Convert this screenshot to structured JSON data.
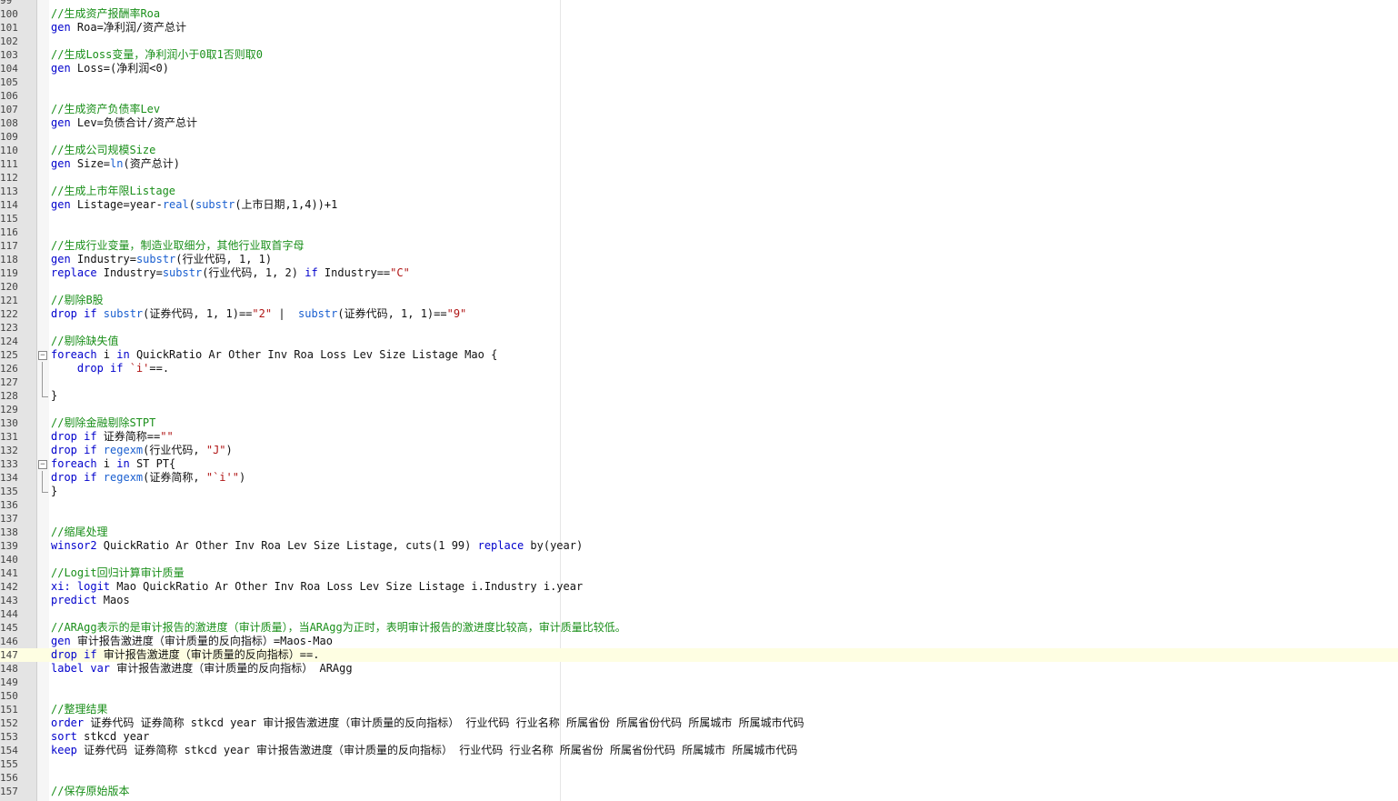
{
  "editor": {
    "current_line": 147,
    "colors": {
      "comment": "#1a8f1a",
      "keyword": "#0000cc",
      "function": "#1a5fd0",
      "string": "#b01515",
      "text": "#111111",
      "gutter": "#e4e4e4",
      "current_line": "#fefee2"
    },
    "lines": [
      {
        "n": "99",
        "tokens": []
      },
      {
        "n": "100",
        "tokens": [
          {
            "t": "c",
            "v": "//生成资产报酬率Roa"
          }
        ]
      },
      {
        "n": "101",
        "tokens": [
          {
            "t": "k",
            "v": "gen "
          },
          {
            "t": "x",
            "v": "Roa=净利润/资产总计"
          }
        ]
      },
      {
        "n": "102",
        "tokens": []
      },
      {
        "n": "103",
        "tokens": [
          {
            "t": "c",
            "v": "//生成Loss变量，净利润小于0取1否则取0"
          }
        ]
      },
      {
        "n": "104",
        "tokens": [
          {
            "t": "k",
            "v": "gen "
          },
          {
            "t": "x",
            "v": "Loss=(净利润<0)"
          }
        ]
      },
      {
        "n": "105",
        "tokens": []
      },
      {
        "n": "106",
        "tokens": []
      },
      {
        "n": "107",
        "tokens": [
          {
            "t": "c",
            "v": "//生成资产负债率Lev"
          }
        ]
      },
      {
        "n": "108",
        "tokens": [
          {
            "t": "k",
            "v": "gen "
          },
          {
            "t": "x",
            "v": "Lev=负债合计/资产总计"
          }
        ]
      },
      {
        "n": "109",
        "tokens": []
      },
      {
        "n": "110",
        "tokens": [
          {
            "t": "c",
            "v": "//生成公司规模Size"
          }
        ]
      },
      {
        "n": "111",
        "tokens": [
          {
            "t": "k",
            "v": "gen "
          },
          {
            "t": "x",
            "v": "Size="
          },
          {
            "t": "f",
            "v": "ln"
          },
          {
            "t": "x",
            "v": "(资产总计)"
          }
        ]
      },
      {
        "n": "112",
        "tokens": []
      },
      {
        "n": "113",
        "tokens": [
          {
            "t": "c",
            "v": "//生成上市年限Listage"
          }
        ]
      },
      {
        "n": "114",
        "tokens": [
          {
            "t": "k",
            "v": "gen "
          },
          {
            "t": "x",
            "v": "Listage=year-"
          },
          {
            "t": "f",
            "v": "real"
          },
          {
            "t": "x",
            "v": "("
          },
          {
            "t": "f",
            "v": "substr"
          },
          {
            "t": "x",
            "v": "(上市日期,1,4))+1"
          }
        ]
      },
      {
        "n": "115",
        "tokens": []
      },
      {
        "n": "116",
        "tokens": []
      },
      {
        "n": "117",
        "tokens": [
          {
            "t": "c",
            "v": "//生成行业变量，制造业取细分，其他行业取首字母"
          }
        ]
      },
      {
        "n": "118",
        "tokens": [
          {
            "t": "k",
            "v": "gen "
          },
          {
            "t": "x",
            "v": "Industry="
          },
          {
            "t": "f",
            "v": "substr"
          },
          {
            "t": "x",
            "v": "(行业代码, 1, 1)"
          }
        ]
      },
      {
        "n": "119",
        "tokens": [
          {
            "t": "k",
            "v": "replace "
          },
          {
            "t": "x",
            "v": "Industry="
          },
          {
            "t": "f",
            "v": "substr"
          },
          {
            "t": "x",
            "v": "(行业代码, 1, 2) "
          },
          {
            "t": "k",
            "v": "if "
          },
          {
            "t": "x",
            "v": "Industry=="
          },
          {
            "t": "s",
            "v": "\"C\""
          }
        ]
      },
      {
        "n": "120",
        "tokens": []
      },
      {
        "n": "121",
        "tokens": [
          {
            "t": "c",
            "v": "//剔除B股"
          }
        ]
      },
      {
        "n": "122",
        "tokens": [
          {
            "t": "k",
            "v": "drop if "
          },
          {
            "t": "f",
            "v": "substr"
          },
          {
            "t": "x",
            "v": "(证券代码, 1, 1)=="
          },
          {
            "t": "s",
            "v": "\"2\""
          },
          {
            "t": "x",
            "v": " |  "
          },
          {
            "t": "f",
            "v": "substr"
          },
          {
            "t": "x",
            "v": "(证券代码, 1, 1)=="
          },
          {
            "t": "s",
            "v": "\"9\""
          }
        ]
      },
      {
        "n": "123",
        "tokens": []
      },
      {
        "n": "124",
        "tokens": [
          {
            "t": "c",
            "v": "//剔除缺失值"
          }
        ]
      },
      {
        "n": "125",
        "fold": "open",
        "tokens": [
          {
            "t": "k",
            "v": "foreach "
          },
          {
            "t": "x",
            "v": "i "
          },
          {
            "t": "k",
            "v": "in "
          },
          {
            "t": "x",
            "v": "QuickRatio Ar Other Inv Roa Loss Lev Size Listage Mao {"
          }
        ]
      },
      {
        "n": "126",
        "fold": "mid",
        "tokens": [
          {
            "t": "x",
            "v": "    "
          },
          {
            "t": "k",
            "v": "drop if "
          },
          {
            "t": "s",
            "v": "`i'"
          },
          {
            "t": "x",
            "v": "==."
          }
        ]
      },
      {
        "n": "127",
        "fold": "mid",
        "tokens": []
      },
      {
        "n": "128",
        "fold": "end",
        "tokens": [
          {
            "t": "x",
            "v": "}"
          }
        ]
      },
      {
        "n": "129",
        "tokens": []
      },
      {
        "n": "130",
        "tokens": [
          {
            "t": "c",
            "v": "//剔除金融剔除STPT"
          }
        ]
      },
      {
        "n": "131",
        "tokens": [
          {
            "t": "k",
            "v": "drop if "
          },
          {
            "t": "x",
            "v": "证券简称=="
          },
          {
            "t": "s",
            "v": "\"\""
          }
        ]
      },
      {
        "n": "132",
        "tokens": [
          {
            "t": "k",
            "v": "drop if "
          },
          {
            "t": "f",
            "v": "regexm"
          },
          {
            "t": "x",
            "v": "(行业代码, "
          },
          {
            "t": "s",
            "v": "\"J\""
          },
          {
            "t": "x",
            "v": ")"
          }
        ]
      },
      {
        "n": "133",
        "fold": "open",
        "tokens": [
          {
            "t": "k",
            "v": "foreach "
          },
          {
            "t": "x",
            "v": "i "
          },
          {
            "t": "k",
            "v": "in "
          },
          {
            "t": "x",
            "v": "ST PT{"
          }
        ]
      },
      {
        "n": "134",
        "fold": "mid",
        "tokens": [
          {
            "t": "k",
            "v": "drop if "
          },
          {
            "t": "f",
            "v": "regexm"
          },
          {
            "t": "x",
            "v": "(证券简称, "
          },
          {
            "t": "s",
            "v": "\"`i'\""
          },
          {
            "t": "x",
            "v": ")"
          }
        ]
      },
      {
        "n": "135",
        "fold": "end",
        "tokens": [
          {
            "t": "x",
            "v": "}"
          }
        ]
      },
      {
        "n": "136",
        "tokens": []
      },
      {
        "n": "137",
        "tokens": []
      },
      {
        "n": "138",
        "tokens": [
          {
            "t": "c",
            "v": "//缩尾处理"
          }
        ]
      },
      {
        "n": "139",
        "tokens": [
          {
            "t": "k",
            "v": "winsor2 "
          },
          {
            "t": "x",
            "v": "QuickRatio Ar Other Inv Roa Lev Size Listage, cuts(1 99) "
          },
          {
            "t": "k",
            "v": "replace "
          },
          {
            "t": "x",
            "v": "by(year)"
          }
        ]
      },
      {
        "n": "140",
        "tokens": []
      },
      {
        "n": "141",
        "tokens": [
          {
            "t": "c",
            "v": "//Logit回归计算审计质量"
          }
        ]
      },
      {
        "n": "142",
        "tokens": [
          {
            "t": "k",
            "v": "xi: logit "
          },
          {
            "t": "x",
            "v": "Mao QuickRatio Ar Other Inv Roa Loss Lev Size Listage i.Industry i.year"
          }
        ]
      },
      {
        "n": "143",
        "tokens": [
          {
            "t": "k",
            "v": "predict "
          },
          {
            "t": "x",
            "v": "Maos"
          }
        ]
      },
      {
        "n": "144",
        "tokens": []
      },
      {
        "n": "145",
        "tokens": [
          {
            "t": "c",
            "v": "//ARAgg表示的是审计报告的激进度（审计质量），当ARAgg为正时，表明审计报告的激进度比较高，审计质量比较低。"
          }
        ]
      },
      {
        "n": "146",
        "tokens": [
          {
            "t": "k",
            "v": "gen "
          },
          {
            "t": "x",
            "v": "审计报告激进度（审计质量的反向指标）=Maos-Mao"
          }
        ]
      },
      {
        "n": "147",
        "tokens": [
          {
            "t": "k",
            "v": "drop if "
          },
          {
            "t": "x",
            "v": "审计报告激进度（审计质量的反向指标）==."
          }
        ]
      },
      {
        "n": "148",
        "tokens": [
          {
            "t": "k",
            "v": "label var "
          },
          {
            "t": "x",
            "v": "审计报告激进度（审计质量的反向指标） ARAgg"
          }
        ]
      },
      {
        "n": "149",
        "tokens": []
      },
      {
        "n": "150",
        "tokens": []
      },
      {
        "n": "151",
        "tokens": [
          {
            "t": "c",
            "v": "//整理结果"
          }
        ]
      },
      {
        "n": "152",
        "tokens": [
          {
            "t": "k",
            "v": "order "
          },
          {
            "t": "x",
            "v": "证券代码 证券简称 stkcd year 审计报告激进度（审计质量的反向指标） 行业代码 行业名称 所属省份 所属省份代码 所属城市 所属城市代码"
          }
        ]
      },
      {
        "n": "153",
        "tokens": [
          {
            "t": "k",
            "v": "sort "
          },
          {
            "t": "x",
            "v": "stkcd year"
          }
        ]
      },
      {
        "n": "154",
        "tokens": [
          {
            "t": "k",
            "v": "keep "
          },
          {
            "t": "x",
            "v": "证券代码 证券简称 stkcd year 审计报告激进度（审计质量的反向指标） 行业代码 行业名称 所属省份 所属省份代码 所属城市 所属城市代码"
          }
        ]
      },
      {
        "n": "155",
        "tokens": []
      },
      {
        "n": "156",
        "tokens": []
      },
      {
        "n": "157",
        "tokens": [
          {
            "t": "c",
            "v": "//保存原始版本"
          }
        ]
      }
    ]
  }
}
